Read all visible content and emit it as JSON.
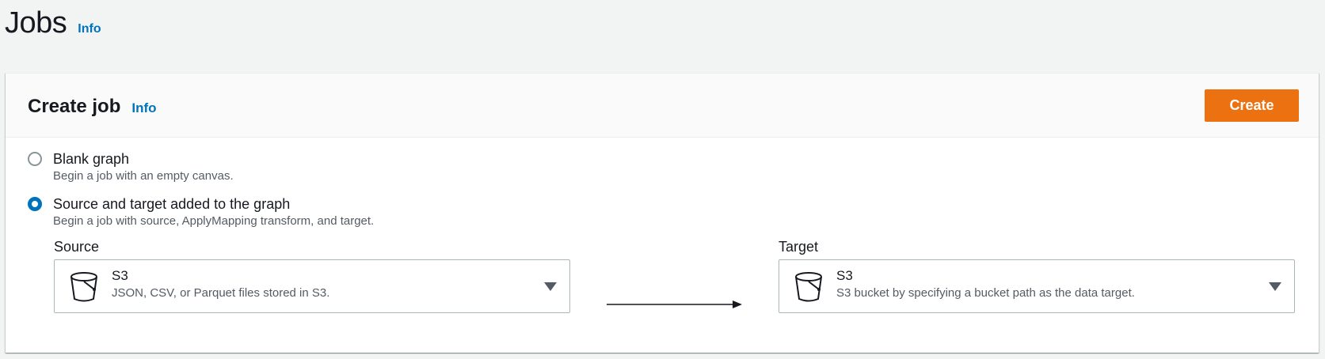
{
  "page": {
    "title": "Jobs",
    "info_label": "Info"
  },
  "panel": {
    "title": "Create job",
    "info_label": "Info",
    "create_button": "Create"
  },
  "options": [
    {
      "label": "Blank graph",
      "description": "Begin a job with an empty canvas.",
      "selected": false
    },
    {
      "label": "Source and target added to the graph",
      "description": "Begin a job with source, ApplyMapping transform, and target.",
      "selected": true
    }
  ],
  "source": {
    "label": "Source",
    "value": "S3",
    "description": "JSON, CSV, or Parquet files stored in S3.",
    "icon": "bucket-icon"
  },
  "target": {
    "label": "Target",
    "value": "S3",
    "description": "S3 bucket by specifying a bucket path as the data target.",
    "icon": "bucket-icon"
  },
  "colors": {
    "primary_button": "#ec7211",
    "link": "#0073bb",
    "page_background": "#f2f3f3"
  }
}
